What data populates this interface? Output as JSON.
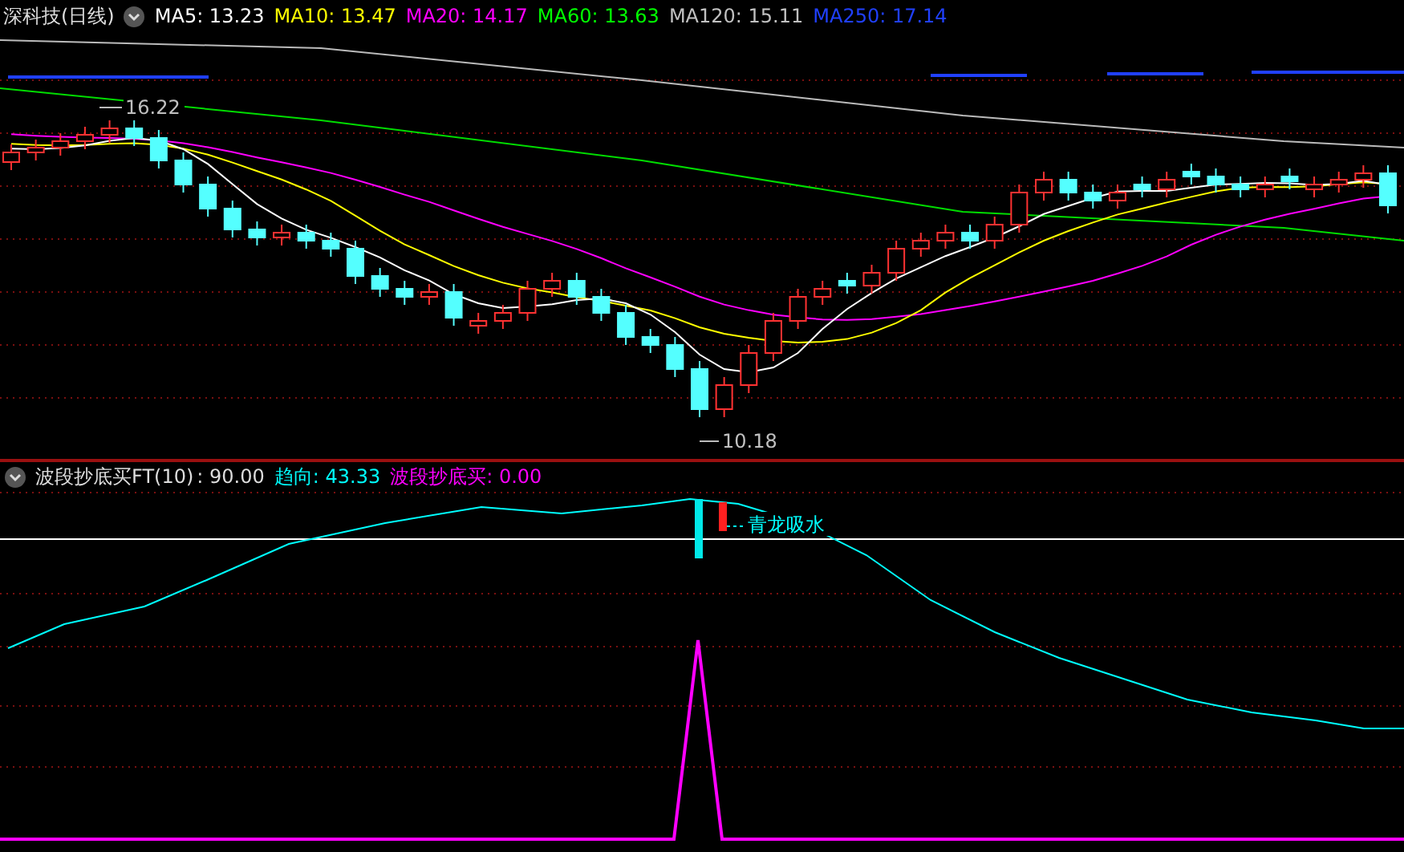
{
  "main_panel": {
    "title": "深科技(日线)",
    "indicators": [
      {
        "label": "MA5: 13.23",
        "color": "#ffffff"
      },
      {
        "label": "MA10: 13.47",
        "color": "#ffff00"
      },
      {
        "label": "MA20: 14.17",
        "color": "#ff00ff"
      },
      {
        "label": "MA60: 13.63",
        "color": "#00ff00"
      },
      {
        "label": "MA120: 15.11",
        "color": "#c0c0c0"
      },
      {
        "label": "MA250: 17.14",
        "color": "#2040ff"
      }
    ],
    "high_label": "16.22",
    "low_label": "10.18"
  },
  "sub_panel": {
    "title": "波段抄底买FT(10)",
    "value": ": 90.00",
    "indicators": [
      {
        "label": "趋向: 43.33",
        "color": "#00ffff"
      },
      {
        "label": "波段抄底买: 0.00",
        "color": "#ff00ff"
      }
    ],
    "signal_label": "青龙吸水"
  }
}
